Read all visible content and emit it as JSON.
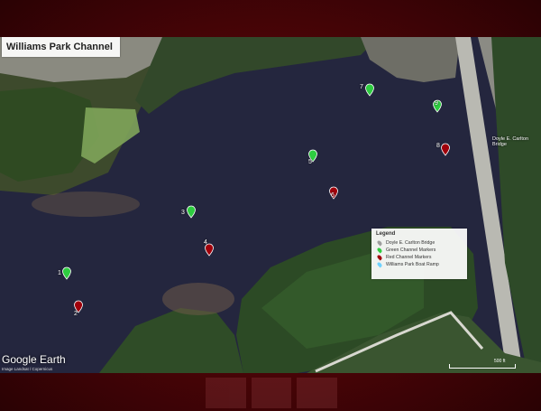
{
  "map_title": "Williams Park Channel",
  "bridge_label": "Doyle E. Carlton Bridge",
  "logo_text": "Google Earth",
  "imagery_credit": "Image Landsat / Copernicus",
  "scale_label": "500 ft",
  "legend": {
    "title": "Legend",
    "items": [
      {
        "label": "Doyle E. Carlton Bridge",
        "color": "#9e9e9e"
      },
      {
        "label": "Green Channel Markers",
        "color": "#2ecc40"
      },
      {
        "label": "Red Channel Markers",
        "color": "#a0000b"
      },
      {
        "label": "Williams Park Boat Ramp",
        "color": "#6fd3ff"
      }
    ]
  },
  "markers": {
    "m1": "1",
    "m2": "2",
    "m3": "3",
    "m4": "4",
    "m5": "5",
    "m6": "6",
    "m7": "7",
    "m8": "8",
    "m9": "9"
  }
}
